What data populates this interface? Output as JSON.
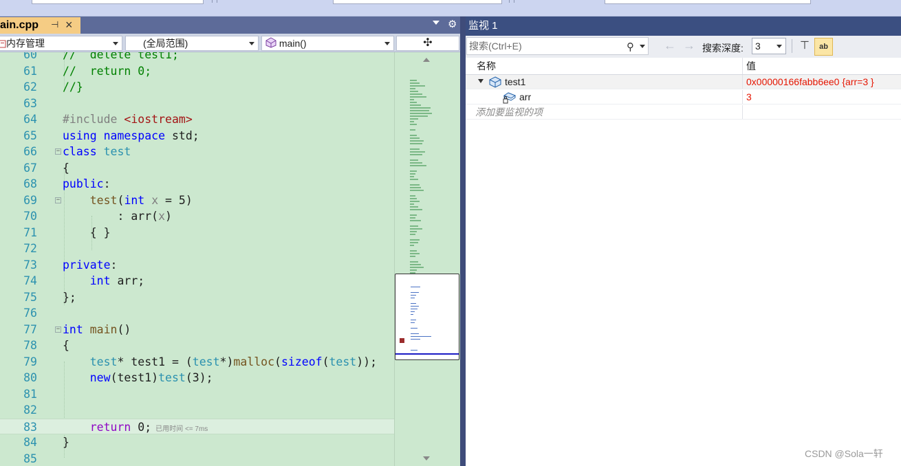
{
  "editor": {
    "file_tab": "ain.cpp",
    "nav": {
      "project": "内存管理",
      "scope": "(全局范围)",
      "member": "main()"
    },
    "current_line_lens": "已用时间 <= 7ms",
    "lines": [
      "60",
      "61",
      "62",
      "63",
      "64",
      "65",
      "66",
      "67",
      "68",
      "69",
      "70",
      "71",
      "72",
      "73",
      "74",
      "75",
      "76",
      "77",
      "78",
      "79",
      "80",
      "81",
      "82",
      "83",
      "84",
      "85"
    ]
  },
  "watch": {
    "title": "监视 1",
    "search_placeholder": "搜索(Ctrl+E)",
    "depth_label": "搜索深度:",
    "depth_value": "3",
    "columns": {
      "name": "名称",
      "value": "值"
    },
    "rows": [
      {
        "name": "test1",
        "value": "0x00000166fabb6ee0 {arr=3 }"
      },
      {
        "name": "arr",
        "value": "3"
      }
    ],
    "add_item": "添加要监视的项"
  },
  "watermark": "CSDN @Sola一轩",
  "colors": {
    "editor_bg": "#cce8cf",
    "tab_active": "#f5cc84",
    "watch_title_bg": "#3b4f81",
    "value_red": "#e51400",
    "line_number": "#2b91af"
  }
}
